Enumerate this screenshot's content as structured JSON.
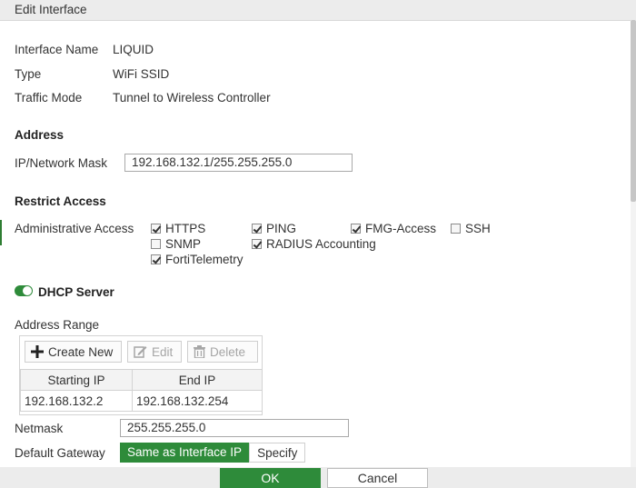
{
  "window": {
    "title": "Edit Interface"
  },
  "info": {
    "interface_name_label": "Interface Name",
    "interface_name_value": "LIQUID",
    "type_label": "Type",
    "type_value": "WiFi SSID",
    "traffic_mode_label": "Traffic Mode",
    "traffic_mode_value": "Tunnel to Wireless Controller"
  },
  "address": {
    "heading": "Address",
    "ip_mask_label": "IP/Network Mask",
    "ip_mask_value": "192.168.132.1/255.255.255.0"
  },
  "restrict": {
    "heading": "Restrict Access",
    "admin_access_label": "Administrative Access",
    "options": [
      {
        "label": "HTTPS",
        "checked": true
      },
      {
        "label": "PING",
        "checked": true
      },
      {
        "label": "FMG-Access",
        "checked": true
      },
      {
        "label": "SSH",
        "checked": false
      },
      {
        "label": "SNMP",
        "checked": false
      },
      {
        "label": "RADIUS Accounting",
        "checked": true
      },
      {
        "label": "FortiTelemetry",
        "checked": true
      }
    ]
  },
  "dhcp": {
    "heading": "DHCP Server",
    "enabled": true,
    "address_range_label": "Address Range",
    "toolbar": {
      "create_new": "Create New",
      "edit": "Edit",
      "delete": "Delete"
    },
    "table": {
      "columns": [
        "Starting IP",
        "End IP"
      ],
      "rows": [
        [
          "192.168.132.2",
          "192.168.132.254"
        ]
      ]
    },
    "netmask_label": "Netmask",
    "netmask_value": "255.255.255.0",
    "gateway_label": "Default Gateway",
    "gateway_options": [
      "Same as Interface IP",
      "Specify"
    ],
    "gateway_selected": "Same as Interface IP"
  },
  "footer": {
    "ok_label": "OK",
    "cancel_label": "Cancel"
  },
  "colors": {
    "accent": "#2e8b3a",
    "titlebar": "#ececec"
  }
}
